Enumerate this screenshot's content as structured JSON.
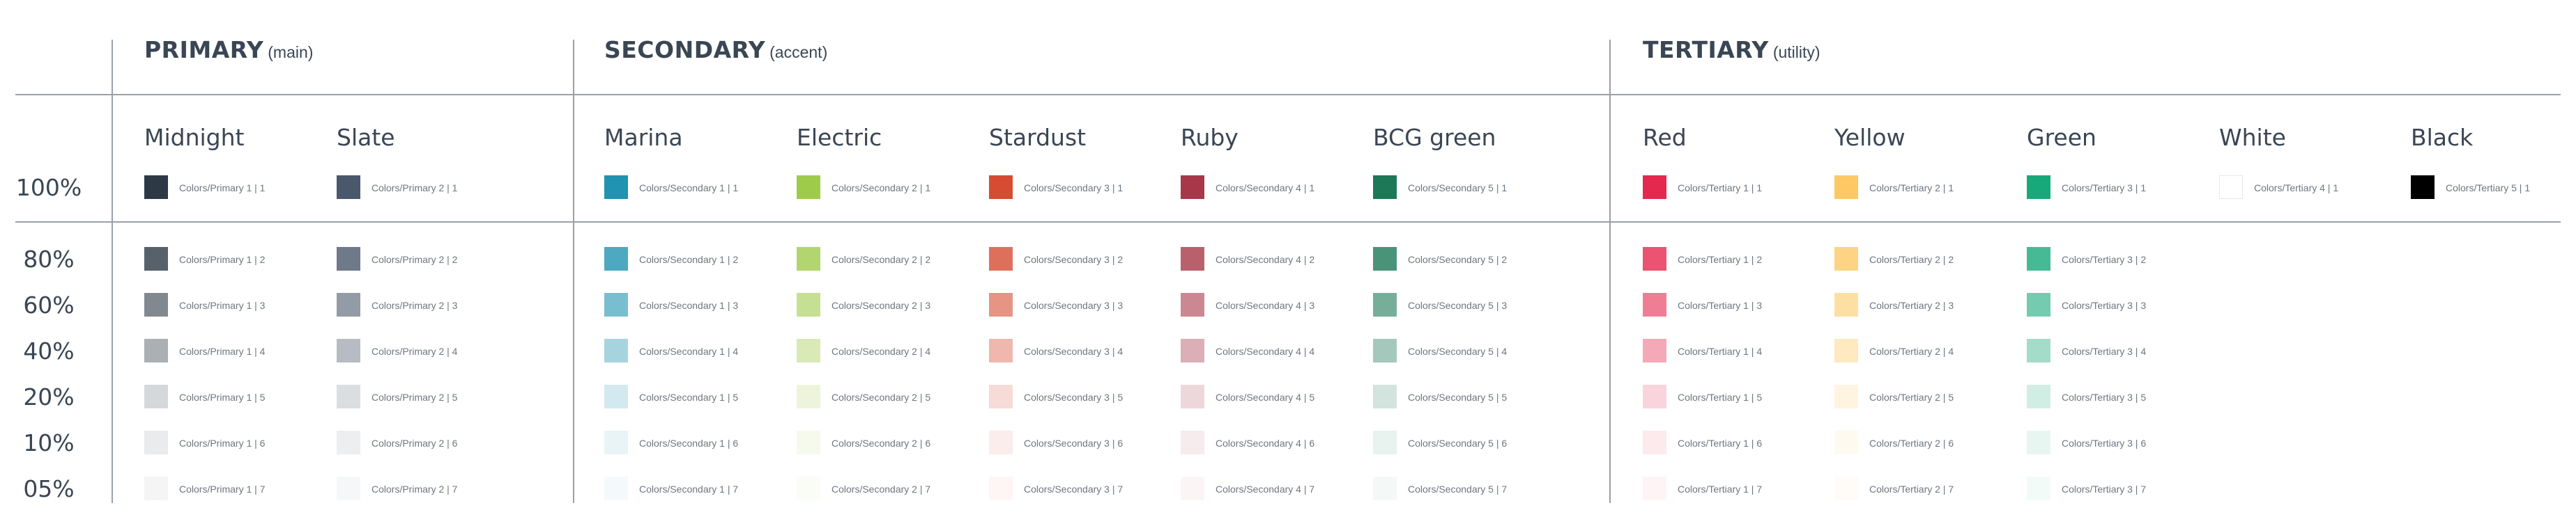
{
  "groups": [
    {
      "title": "PRIMARY",
      "subtitle": "(main)"
    },
    {
      "title": "SECONDARY",
      "subtitle": "(accent)"
    },
    {
      "title": "TERTIARY",
      "subtitle": "(utility)"
    }
  ],
  "percent_labels": [
    "100%",
    "80%",
    "60%",
    "40%",
    "20%",
    "10%",
    "05%"
  ],
  "columns": [
    {
      "name": "Midnight",
      "group": "Primary",
      "index": 1,
      "shades": 7,
      "color": "#2d3a46"
    },
    {
      "name": "Slate",
      "group": "Primary",
      "index": 2,
      "shades": 7,
      "color": "#4a586b"
    },
    {
      "name": "Marina",
      "group": "Secondary",
      "index": 1,
      "shades": 7,
      "color": "#1f93b0"
    },
    {
      "name": "Electric",
      "group": "Secondary",
      "index": 2,
      "shades": 7,
      "color": "#9fcb4b"
    },
    {
      "name": "Stardust",
      "group": "Secondary",
      "index": 3,
      "shades": 7,
      "color": "#d64c32"
    },
    {
      "name": "Ruby",
      "group": "Secondary",
      "index": 4,
      "shades": 7,
      "color": "#a83849"
    },
    {
      "name": "BCG green",
      "group": "Secondary",
      "index": 5,
      "shades": 7,
      "color": "#1c7857"
    },
    {
      "name": "Red",
      "group": "Tertiary",
      "index": 1,
      "shades": 7,
      "color": "#e5284e"
    },
    {
      "name": "Yellow",
      "group": "Tertiary",
      "index": 2,
      "shades": 7,
      "color": "#fdc965"
    },
    {
      "name": "Green",
      "group": "Tertiary",
      "index": 3,
      "shades": 7,
      "color": "#18a97b"
    },
    {
      "name": "White",
      "group": "Tertiary",
      "index": 4,
      "shades": 1,
      "color": "#ffffff"
    },
    {
      "name": "Black",
      "group": "Tertiary",
      "index": 5,
      "shades": 1,
      "color": "#000000"
    }
  ]
}
